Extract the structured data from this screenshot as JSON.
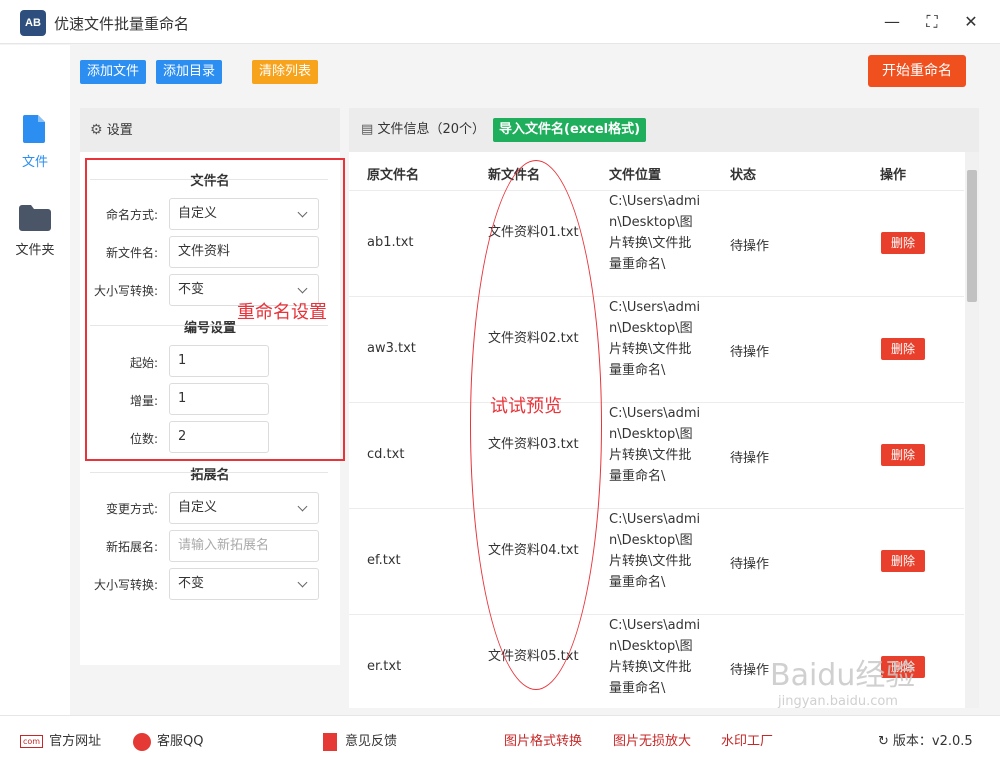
{
  "app": {
    "title": "优速文件批量重命名",
    "logo_text": "AB"
  },
  "window_buttons": {
    "minimize": "—",
    "maximize": "⛶",
    "close": "✕"
  },
  "sidebar": {
    "items": [
      {
        "label": "文件",
        "icon": "file-icon"
      },
      {
        "label": "文件夹",
        "icon": "folder-icon"
      }
    ]
  },
  "toolbar": {
    "add_file": "添加文件",
    "add_dir": "添加目录",
    "clear_list": "清除列表",
    "start": "开始重命名"
  },
  "settings": {
    "header": "设置",
    "filename_section": "文件名",
    "naming_mode_label": "命名方式:",
    "naming_mode_value": "自定义",
    "new_name_label": "新文件名:",
    "new_name_value": "文件资料",
    "case_label": "大小写转换:",
    "case_value": "不变",
    "numbering_section": "编号设置",
    "start_label": "起始:",
    "start_value": "1",
    "step_label": "增量:",
    "step_value": "1",
    "digits_label": "位数:",
    "digits_value": "2",
    "ext_section": "拓展名",
    "ext_mode_label": "变更方式:",
    "ext_mode_value": "自定义",
    "new_ext_label": "新拓展名:",
    "new_ext_placeholder": "请输入新拓展名",
    "ext_case_label": "大小写转换:",
    "ext_case_value": "不变"
  },
  "annotations": {
    "rename_settings": "重命名设置",
    "preview": "试试预览"
  },
  "file_panel": {
    "title": "文件信息（20个）",
    "import_button": "导入文件名(excel格式)",
    "columns": [
      "原文件名",
      "新文件名",
      "文件位置",
      "状态",
      "操作"
    ],
    "rows": [
      {
        "orig": "ab1.txt",
        "new": "文件资料01.txt",
        "loc": "C:\\Users\\admin\\Desktop\\图片转换\\文件批量重命名\\",
        "status": "待操作",
        "action": "删除"
      },
      {
        "orig": "aw3.txt",
        "new": "文件资料02.txt",
        "loc": "C:\\Users\\admin\\Desktop\\图片转换\\文件批量重命名\\",
        "status": "待操作",
        "action": "删除"
      },
      {
        "orig": "cd.txt",
        "new": "文件资料03.txt",
        "loc": "C:\\Users\\admin\\Desktop\\图片转换\\文件批量重命名\\",
        "status": "待操作",
        "action": "删除"
      },
      {
        "orig": "ef.txt",
        "new": "文件资料04.txt",
        "loc": "C:\\Users\\admin\\Desktop\\图片转换\\文件批量重命名\\",
        "status": "待操作",
        "action": "删除"
      },
      {
        "orig": "er.txt",
        "new": "文件资料05.txt",
        "loc": "C:\\Users\\admin\\Desktop\\图片转换\\文件批量重命名\\",
        "status": "待操作",
        "action": "删除"
      }
    ]
  },
  "footer": {
    "website": "官方网址",
    "support": "客服QQ",
    "feedback": "意见反馈",
    "img_convert": "图片格式转换",
    "img_enlarge": "图片无损放大",
    "watermark_tool": "水印工厂",
    "version": "版本：v2.0.5"
  },
  "watermark": {
    "main": "Baidu经验",
    "sub": "jingyan.baidu.com"
  },
  "colors": {
    "accent_blue": "#2b8ef0",
    "accent_red": "#f0501e",
    "green": "#1fae5b",
    "annotation_red": "#e8333a"
  }
}
